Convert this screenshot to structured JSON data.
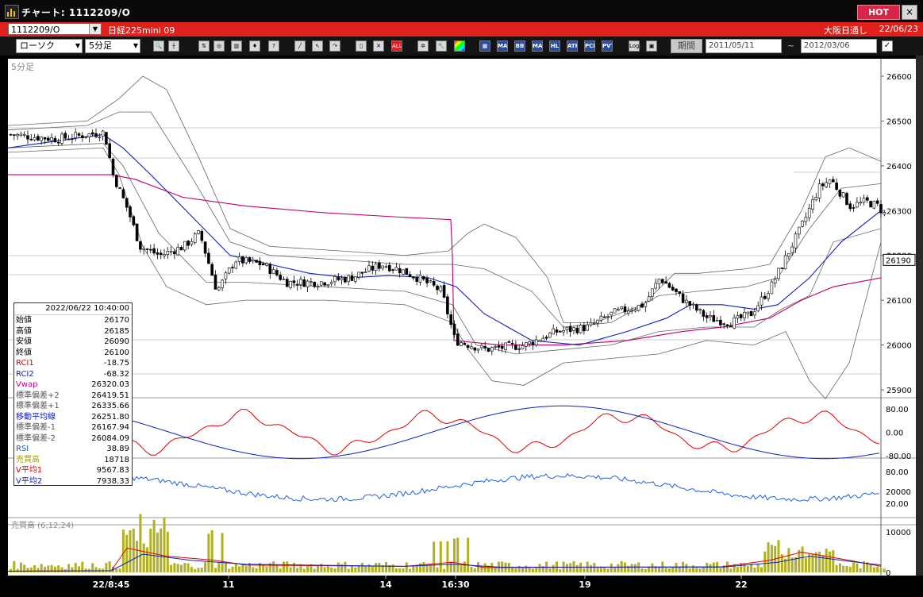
{
  "window": {
    "title": "チャート: 1112209/O",
    "hot_label": "HOT",
    "close_label": "×"
  },
  "infobar": {
    "symbol": "1112209/O",
    "instrument": "日経225mini 09",
    "exchange": "大阪日通し",
    "date": "22/06/23"
  },
  "toolbar": {
    "chart_type": "ローソク",
    "interval": "5分足",
    "period_label": "期間",
    "start_date": "2011/05/11",
    "end_date": "2012/03/06",
    "tilde": "~",
    "buttons": [
      "MA",
      "BB",
      "MAE",
      "HL",
      "ATR",
      "PCN",
      "PVT",
      "Log"
    ]
  },
  "chart": {
    "interval_label": "5分足",
    "price_ticks": [
      "26600",
      "26500",
      "26400",
      "26300",
      "26200",
      "26100",
      "26000",
      "25900"
    ],
    "current_price": "26190",
    "osc_ticks": [
      "80.00",
      "0.00",
      "-80.00"
    ],
    "rsi_ticks": [
      "80.00",
      "20.00"
    ],
    "vol_ticks": [
      "20000",
      "10000",
      "0"
    ],
    "volume_label": "売買高 (6,12,24)",
    "x_labels": [
      "22/8:45",
      "11",
      "14",
      "16:30",
      "19",
      "22"
    ]
  },
  "databox": {
    "datetime": "2022/06/22  10:40:00",
    "rows": [
      {
        "k": "始値",
        "v": "26170",
        "c": "#000000"
      },
      {
        "k": "高値",
        "v": "26185",
        "c": "#000000"
      },
      {
        "k": "安値",
        "v": "26090",
        "c": "#000000"
      },
      {
        "k": "終値",
        "v": "26100",
        "c": "#000000"
      },
      {
        "k": "RCI1",
        "v": "-18.75",
        "c": "#e00000"
      },
      {
        "k": "RCI2",
        "v": "-68.32",
        "c": "#1020c0"
      },
      {
        "k": "Vwap",
        "v": "26320.03",
        "c": "#d0008c"
      },
      {
        "k": "標準偏差+2",
        "v": "26419.51",
        "c": "#555555"
      },
      {
        "k": "標準偏差+1",
        "v": "26335.66",
        "c": "#555555"
      },
      {
        "k": "移動平均線",
        "v": "26251.80",
        "c": "#1020c0"
      },
      {
        "k": "標準偏差-1",
        "v": "26167.94",
        "c": "#555555"
      },
      {
        "k": "標準偏差-2",
        "v": "26084.09",
        "c": "#555555"
      },
      {
        "k": "RSI",
        "v": "38.89",
        "c": "#1060e0"
      },
      {
        "k": "売買高",
        "v": "18718",
        "c": "#a0a000"
      },
      {
        "k": "V平均1",
        "v": "9567.83",
        "c": "#e00000"
      },
      {
        "k": "V平均2",
        "v": "7938.33",
        "c": "#1020c0"
      }
    ]
  },
  "colors": {
    "rci1": "#e00000",
    "rci2": "#1020c0",
    "vwap": "#c0006a",
    "ma": "#1020c0",
    "bb": "#666666",
    "rsi": "#2060e0",
    "volume": "#b0b020"
  }
}
